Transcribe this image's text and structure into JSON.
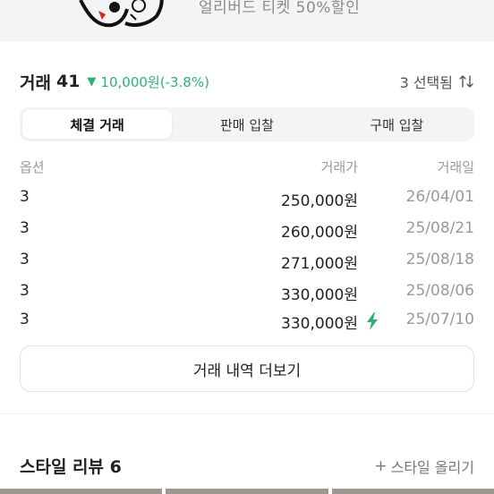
{
  "banner": {
    "text": "얼리버드 티켓 50%할인"
  },
  "summary": {
    "title": "거래",
    "count": "41",
    "arrow": "▼",
    "change": "10,000원(-3.8%)",
    "change_color": "#2db36f",
    "selected": "3 선택됨",
    "sort_icon": "sort-icon"
  },
  "tabs": [
    {
      "label": "체결 거래",
      "active": true
    },
    {
      "label": "판매 입찰",
      "active": false
    },
    {
      "label": "구매 입찰",
      "active": false
    }
  ],
  "table": {
    "headers": {
      "option": "옵션",
      "price": "거래가",
      "date": "거래일"
    },
    "rows": [
      {
        "option": "3",
        "price": "250,000원",
        "date": "26/04/01",
        "instant": false
      },
      {
        "option": "3",
        "price": "260,000원",
        "date": "25/08/21",
        "instant": false
      },
      {
        "option": "3",
        "price": "271,000원",
        "date": "25/08/18",
        "instant": false
      },
      {
        "option": "3",
        "price": "330,000원",
        "date": "25/08/06",
        "instant": false
      },
      {
        "option": "3",
        "price": "330,000원",
        "date": "25/07/10",
        "instant": true
      }
    ]
  },
  "more_button": "거래 내역 더보기",
  "review": {
    "title": "스타일 리뷰 6",
    "upload_icon": "+",
    "upload": "스타일 올리기"
  }
}
